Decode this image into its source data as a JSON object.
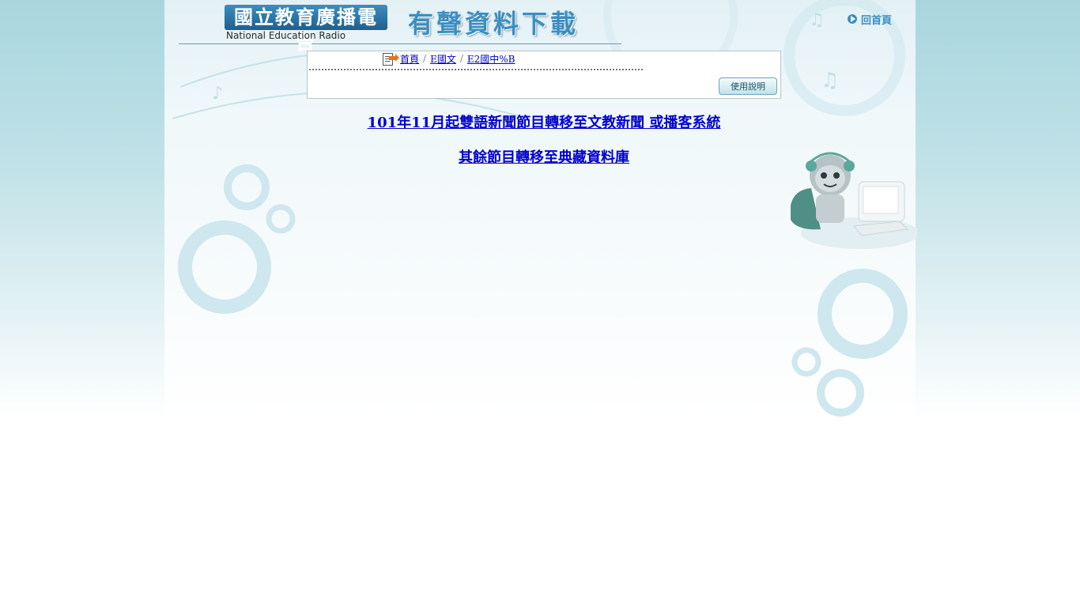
{
  "header": {
    "logo_title": "國立教育廣播電台",
    "logo_subtitle": "National Education Radio",
    "page_heading": "有聲資料下載",
    "home_link_label": "回首頁"
  },
  "breadcrumb": {
    "items": [
      {
        "label": "首頁"
      },
      {
        "label": "E國文"
      },
      {
        "label": "E2國中%B"
      }
    ],
    "separator": "/"
  },
  "toolbar": {
    "help_button_label": "使用說明"
  },
  "notices": [
    {
      "text": "101年11月起雙語新聞節目轉移至文教新聞 或播客系統"
    },
    {
      "text": "其餘節目轉移至典藏資料庫"
    }
  ],
  "colors": {
    "link": "#0000cc",
    "accent": "#3a8fc1",
    "page_background": "#a9d6de"
  },
  "icons": [
    "home-arrow-icon",
    "document-arrow-icon",
    "mascot-illustration"
  ]
}
